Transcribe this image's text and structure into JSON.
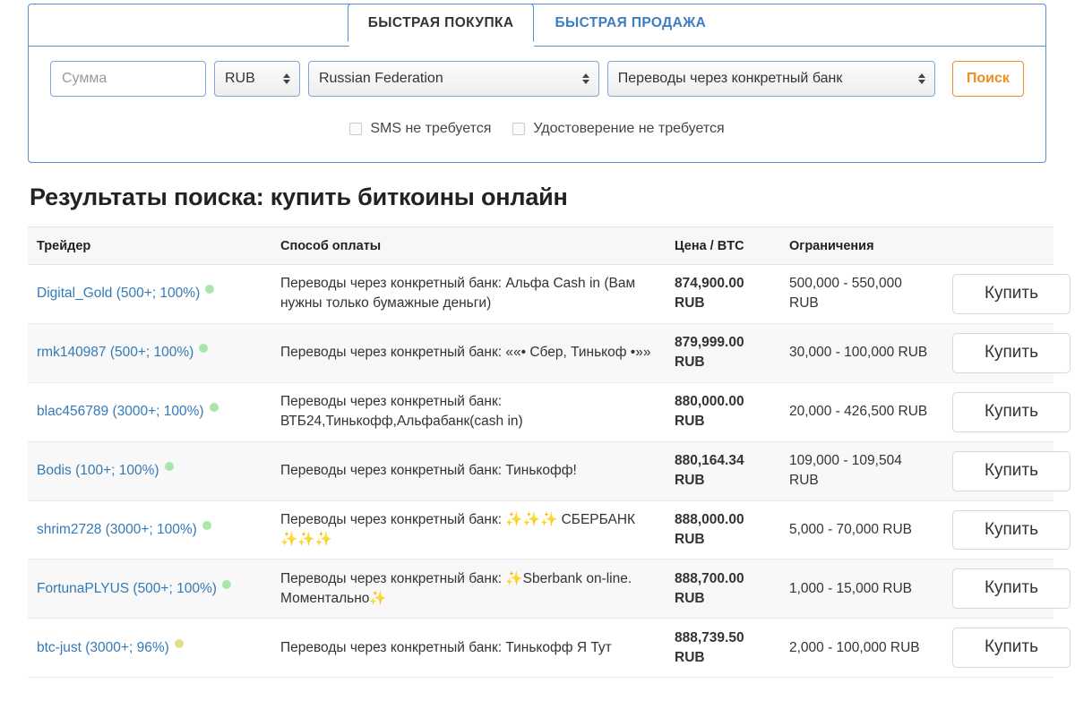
{
  "panel": {
    "tabs": [
      {
        "label": "БЫСТРАЯ ПОКУПКА",
        "active": true
      },
      {
        "label": "БЫСТРАЯ ПРОДАЖА",
        "active": false
      }
    ],
    "amount": {
      "value": "",
      "placeholder": "Сумма"
    },
    "currency": {
      "selected": "RUB"
    },
    "country": {
      "selected": "Russian Federation"
    },
    "method": {
      "selected": "Переводы через конкретный банк"
    },
    "search_button": "Поиск",
    "checkboxes": [
      {
        "label": "SMS не требуется",
        "checked": false
      },
      {
        "label": "Удостоверение не требуется",
        "checked": false
      }
    ]
  },
  "results": {
    "title": "Результаты поиска: купить биткоины онлайн",
    "columns": [
      "Трейдер",
      "Способ оплаты",
      "Цена / BTC",
      "Ограничения",
      ""
    ],
    "buy_label": "Купить",
    "rows": [
      {
        "trader": "Digital_Gold (500+; 100%)",
        "status": "green",
        "method": "Переводы через конкретный банк: Альфа Cash in (Вам нужны только бумажные деньги)",
        "price": "874,900.00 RUB",
        "limits": "500,000 - 550,000 RUB"
      },
      {
        "trader": "rmk140987 (500+; 100%)",
        "status": "green",
        "method": "Переводы через конкретный банк: ««• Сбер, Тинькоф •»»",
        "price": "879,999.00 RUB",
        "limits": "30,000 - 100,000 RUB"
      },
      {
        "trader": "blac456789 (3000+; 100%)",
        "status": "green",
        "method": "Переводы через конкретный банк: ВТБ24,Тинькофф,Альфабанк(cash in)",
        "price": "880,000.00 RUB",
        "limits": "20,000 - 426,500 RUB"
      },
      {
        "trader": "Bodis (100+; 100%)",
        "status": "green",
        "method": "Переводы через конкретный банк: Тинькофф!",
        "price": "880,164.34 RUB",
        "limits": "109,000 - 109,504 RUB"
      },
      {
        "trader": "shrim2728 (3000+; 100%)",
        "status": "green",
        "method": "Переводы через конкретный банк: ✨✨✨ СБЕРБАНК ✨✨✨",
        "price": "888,000.00 RUB",
        "limits": "5,000 - 70,000 RUB"
      },
      {
        "trader": "FortunaPLYUS (500+; 100%)",
        "status": "green",
        "method": "Переводы через конкретный банк: ✨Sberbank on-line. Моментально✨",
        "price": "888,700.00 RUB",
        "limits": "1,000 - 15,000 RUB"
      },
      {
        "trader": "btc-just (3000+; 96%)",
        "status": "yellow",
        "method": "Переводы через конкретный банк: Тинькофф Я Тут",
        "price": "888,739.50 RUB",
        "limits": "2,000 - 100,000 RUB"
      }
    ]
  },
  "colors": {
    "panel_border": "#5b8fce",
    "tab_inactive": "#3b7dc4",
    "accent_orange": "#ef8c22",
    "price_green": "#2a7a2a",
    "link_blue": "#337ab7",
    "status_green": "#a9e6a9",
    "status_yellow": "#e0dd8c"
  }
}
